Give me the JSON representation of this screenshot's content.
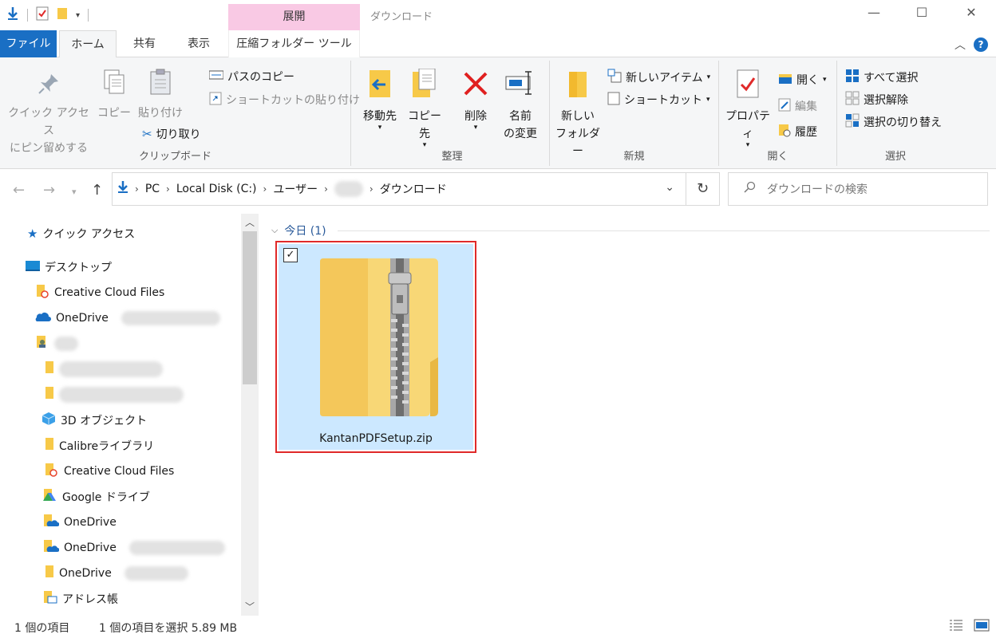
{
  "window": {
    "title": "ダウンロード",
    "context_tab_header": "展開",
    "controls": {
      "minimize": "—",
      "maximize": "☐",
      "close": "✕"
    }
  },
  "tabs": [
    {
      "label": "ファイル"
    },
    {
      "label": "ホーム"
    },
    {
      "label": "共有"
    },
    {
      "label": "表示"
    },
    {
      "label": "圧縮フォルダー ツール"
    }
  ],
  "ribbon": {
    "clipboard": {
      "label": "クリップボード",
      "pin_line1": "クイック アクセス",
      "pin_line2": "にピン留めする",
      "copy": "コピー",
      "paste": "貼り付け",
      "copy_path": "パスのコピー",
      "paste_shortcut": "ショートカットの貼り付け",
      "cut": "切り取り"
    },
    "organize": {
      "label": "整理",
      "move_to": "移動先",
      "copy_to": "コピー先",
      "delete": "削除",
      "rename_line1": "名前",
      "rename_line2": "の変更"
    },
    "new": {
      "label": "新規",
      "new_folder_line1": "新しい",
      "new_folder_line2": "フォルダー",
      "new_item": "新しいアイテム",
      "easy_access": "ショートカット"
    },
    "open": {
      "label": "開く",
      "properties": "プロパティ",
      "open": "開く",
      "edit": "編集",
      "history": "履歴"
    },
    "select": {
      "label": "選択",
      "select_all": "すべて選択",
      "select_none": "選択解除",
      "invert": "選択の切り替え"
    }
  },
  "address": {
    "crumbs": [
      "PC",
      "Local Disk (C:)",
      "ユーザー",
      "ダウンロード"
    ],
    "search_placeholder": "ダウンロードの検索"
  },
  "sidebar": {
    "items": [
      {
        "label": "クイック アクセス"
      },
      {
        "label": "デスクトップ"
      },
      {
        "label": "Creative Cloud Files"
      },
      {
        "label": "OneDrive"
      },
      {
        "label": ""
      },
      {
        "label": ""
      },
      {
        "label": ""
      },
      {
        "label": "3D オブジェクト"
      },
      {
        "label": "Calibreライブラリ"
      },
      {
        "label": "Creative Cloud Files"
      },
      {
        "label": "Google ドライブ"
      },
      {
        "label": "OneDrive"
      },
      {
        "label": "OneDrive"
      },
      {
        "label": "OneDrive"
      },
      {
        "label": "アドレス帳"
      }
    ]
  },
  "content": {
    "group_header": "今日 (1)",
    "file_name": "KantanPDFSetup.zip"
  },
  "status": {
    "item_count": "1 個の項目",
    "selection": "1 個の項目を選択  5.89 MB"
  },
  "colors": {
    "accent": "#1a6fc4",
    "context_tab": "#f9c9e4",
    "selection_fill": "#cce8ff",
    "highlight_border": "#e02a2a"
  }
}
